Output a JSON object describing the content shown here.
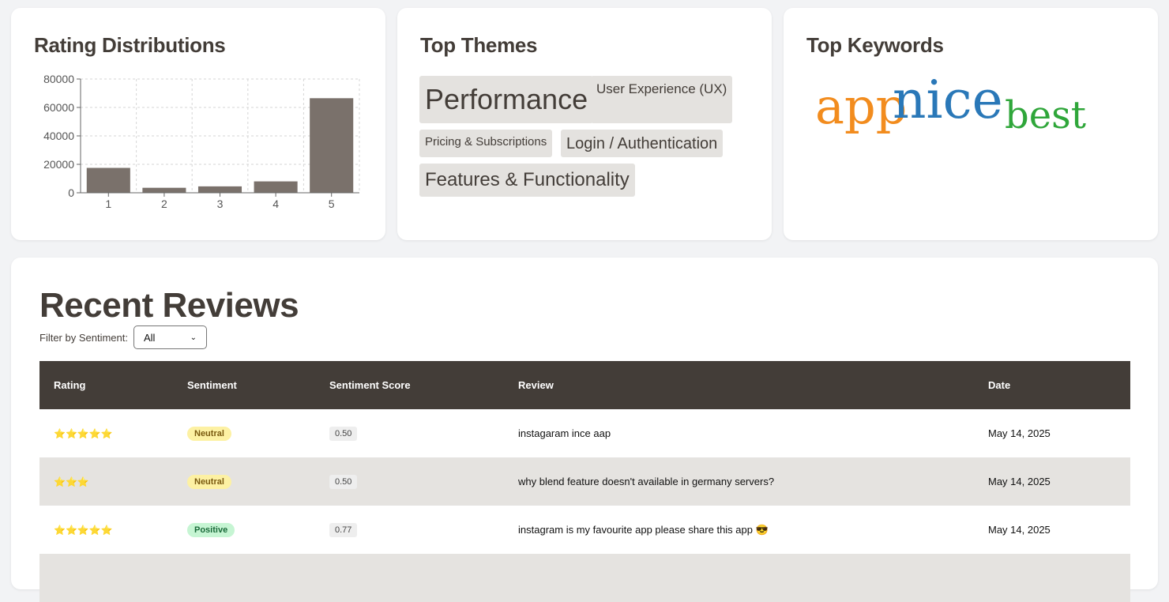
{
  "rating_card": {
    "title": "Rating Distributions"
  },
  "chart_data": {
    "type": "bar",
    "title": "",
    "xlabel": "",
    "ylabel": "",
    "categories": [
      "1",
      "2",
      "3",
      "4",
      "5"
    ],
    "values": [
      17500,
      3500,
      4500,
      8000,
      66500
    ],
    "ylim": [
      0,
      80000
    ],
    "yticks": [
      0,
      20000,
      40000,
      60000,
      80000
    ],
    "grid": true,
    "bar_color": "#7a716b"
  },
  "themes_card": {
    "title": "Top Themes",
    "themes": [
      {
        "label": "Performance",
        "size": "xl"
      },
      {
        "label": "User Experience (UX)",
        "size": "s"
      },
      {
        "label": "Pricing & Subscriptions",
        "size": "xs"
      },
      {
        "label": "Login / Authentication",
        "size": "m"
      },
      {
        "label": "Features & Functionality",
        "size": "l"
      }
    ]
  },
  "keywords_card": {
    "title": "Top Keywords",
    "keywords": [
      {
        "text": "app",
        "color": "#f28c1e"
      },
      {
        "text": "nice",
        "color": "#2a78b8"
      },
      {
        "text": "best",
        "color": "#2fa63a"
      }
    ]
  },
  "reviews": {
    "title": "Recent Reviews",
    "filter_label": "Filter by Sentiment:",
    "filter_value": "All",
    "columns": [
      "Rating",
      "Sentiment",
      "Sentiment Score",
      "Review",
      "Date"
    ],
    "rows": [
      {
        "rating": 5,
        "stars": "⭐⭐⭐⭐⭐",
        "sentiment": "Neutral",
        "score": "0.50",
        "review": "instagaram ince aap",
        "date": "May 14, 2025"
      },
      {
        "rating": 3,
        "stars": "⭐⭐⭐",
        "sentiment": "Neutral",
        "score": "0.50",
        "review": "why blend feature doesn't available in germany servers?",
        "date": "May 14, 2025"
      },
      {
        "rating": 5,
        "stars": "⭐⭐⭐⭐⭐",
        "sentiment": "Positive",
        "score": "0.77",
        "review": "instagram is my favourite app please share this app 😎",
        "date": "May 14, 2025"
      }
    ]
  }
}
